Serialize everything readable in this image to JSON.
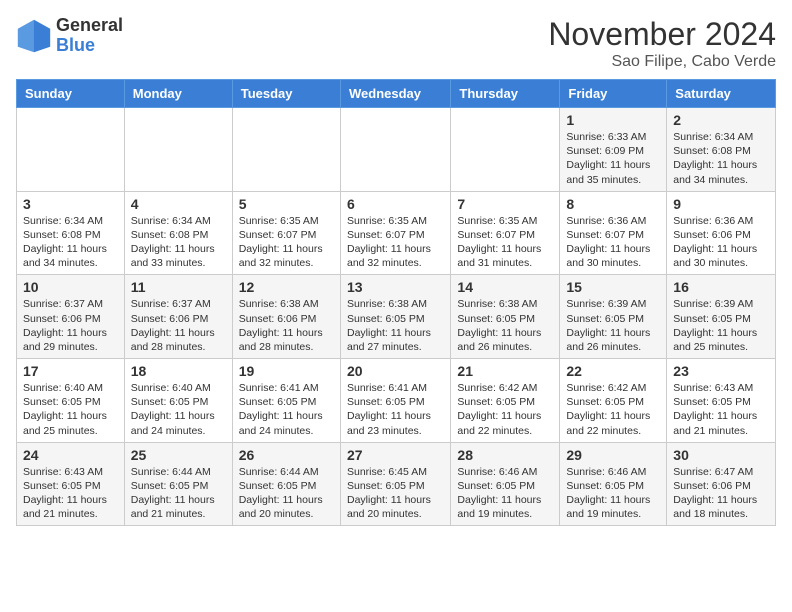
{
  "logo": {
    "general": "General",
    "blue": "Blue"
  },
  "header": {
    "title": "November 2024",
    "subtitle": "Sao Filipe, Cabo Verde"
  },
  "weekdays": [
    "Sunday",
    "Monday",
    "Tuesday",
    "Wednesday",
    "Thursday",
    "Friday",
    "Saturday"
  ],
  "weeks": [
    [
      {
        "day": "",
        "info": ""
      },
      {
        "day": "",
        "info": ""
      },
      {
        "day": "",
        "info": ""
      },
      {
        "day": "",
        "info": ""
      },
      {
        "day": "",
        "info": ""
      },
      {
        "day": "1",
        "info": "Sunrise: 6:33 AM\nSunset: 6:09 PM\nDaylight: 11 hours and 35 minutes."
      },
      {
        "day": "2",
        "info": "Sunrise: 6:34 AM\nSunset: 6:08 PM\nDaylight: 11 hours and 34 minutes."
      }
    ],
    [
      {
        "day": "3",
        "info": "Sunrise: 6:34 AM\nSunset: 6:08 PM\nDaylight: 11 hours and 34 minutes."
      },
      {
        "day": "4",
        "info": "Sunrise: 6:34 AM\nSunset: 6:08 PM\nDaylight: 11 hours and 33 minutes."
      },
      {
        "day": "5",
        "info": "Sunrise: 6:35 AM\nSunset: 6:07 PM\nDaylight: 11 hours and 32 minutes."
      },
      {
        "day": "6",
        "info": "Sunrise: 6:35 AM\nSunset: 6:07 PM\nDaylight: 11 hours and 32 minutes."
      },
      {
        "day": "7",
        "info": "Sunrise: 6:35 AM\nSunset: 6:07 PM\nDaylight: 11 hours and 31 minutes."
      },
      {
        "day": "8",
        "info": "Sunrise: 6:36 AM\nSunset: 6:07 PM\nDaylight: 11 hours and 30 minutes."
      },
      {
        "day": "9",
        "info": "Sunrise: 6:36 AM\nSunset: 6:06 PM\nDaylight: 11 hours and 30 minutes."
      }
    ],
    [
      {
        "day": "10",
        "info": "Sunrise: 6:37 AM\nSunset: 6:06 PM\nDaylight: 11 hours and 29 minutes."
      },
      {
        "day": "11",
        "info": "Sunrise: 6:37 AM\nSunset: 6:06 PM\nDaylight: 11 hours and 28 minutes."
      },
      {
        "day": "12",
        "info": "Sunrise: 6:38 AM\nSunset: 6:06 PM\nDaylight: 11 hours and 28 minutes."
      },
      {
        "day": "13",
        "info": "Sunrise: 6:38 AM\nSunset: 6:05 PM\nDaylight: 11 hours and 27 minutes."
      },
      {
        "day": "14",
        "info": "Sunrise: 6:38 AM\nSunset: 6:05 PM\nDaylight: 11 hours and 26 minutes."
      },
      {
        "day": "15",
        "info": "Sunrise: 6:39 AM\nSunset: 6:05 PM\nDaylight: 11 hours and 26 minutes."
      },
      {
        "day": "16",
        "info": "Sunrise: 6:39 AM\nSunset: 6:05 PM\nDaylight: 11 hours and 25 minutes."
      }
    ],
    [
      {
        "day": "17",
        "info": "Sunrise: 6:40 AM\nSunset: 6:05 PM\nDaylight: 11 hours and 25 minutes."
      },
      {
        "day": "18",
        "info": "Sunrise: 6:40 AM\nSunset: 6:05 PM\nDaylight: 11 hours and 24 minutes."
      },
      {
        "day": "19",
        "info": "Sunrise: 6:41 AM\nSunset: 6:05 PM\nDaylight: 11 hours and 24 minutes."
      },
      {
        "day": "20",
        "info": "Sunrise: 6:41 AM\nSunset: 6:05 PM\nDaylight: 11 hours and 23 minutes."
      },
      {
        "day": "21",
        "info": "Sunrise: 6:42 AM\nSunset: 6:05 PM\nDaylight: 11 hours and 22 minutes."
      },
      {
        "day": "22",
        "info": "Sunrise: 6:42 AM\nSunset: 6:05 PM\nDaylight: 11 hours and 22 minutes."
      },
      {
        "day": "23",
        "info": "Sunrise: 6:43 AM\nSunset: 6:05 PM\nDaylight: 11 hours and 21 minutes."
      }
    ],
    [
      {
        "day": "24",
        "info": "Sunrise: 6:43 AM\nSunset: 6:05 PM\nDaylight: 11 hours and 21 minutes."
      },
      {
        "day": "25",
        "info": "Sunrise: 6:44 AM\nSunset: 6:05 PM\nDaylight: 11 hours and 21 minutes."
      },
      {
        "day": "26",
        "info": "Sunrise: 6:44 AM\nSunset: 6:05 PM\nDaylight: 11 hours and 20 minutes."
      },
      {
        "day": "27",
        "info": "Sunrise: 6:45 AM\nSunset: 6:05 PM\nDaylight: 11 hours and 20 minutes."
      },
      {
        "day": "28",
        "info": "Sunrise: 6:46 AM\nSunset: 6:05 PM\nDaylight: 11 hours and 19 minutes."
      },
      {
        "day": "29",
        "info": "Sunrise: 6:46 AM\nSunset: 6:05 PM\nDaylight: 11 hours and 19 minutes."
      },
      {
        "day": "30",
        "info": "Sunrise: 6:47 AM\nSunset: 6:06 PM\nDaylight: 11 hours and 18 minutes."
      }
    ]
  ]
}
